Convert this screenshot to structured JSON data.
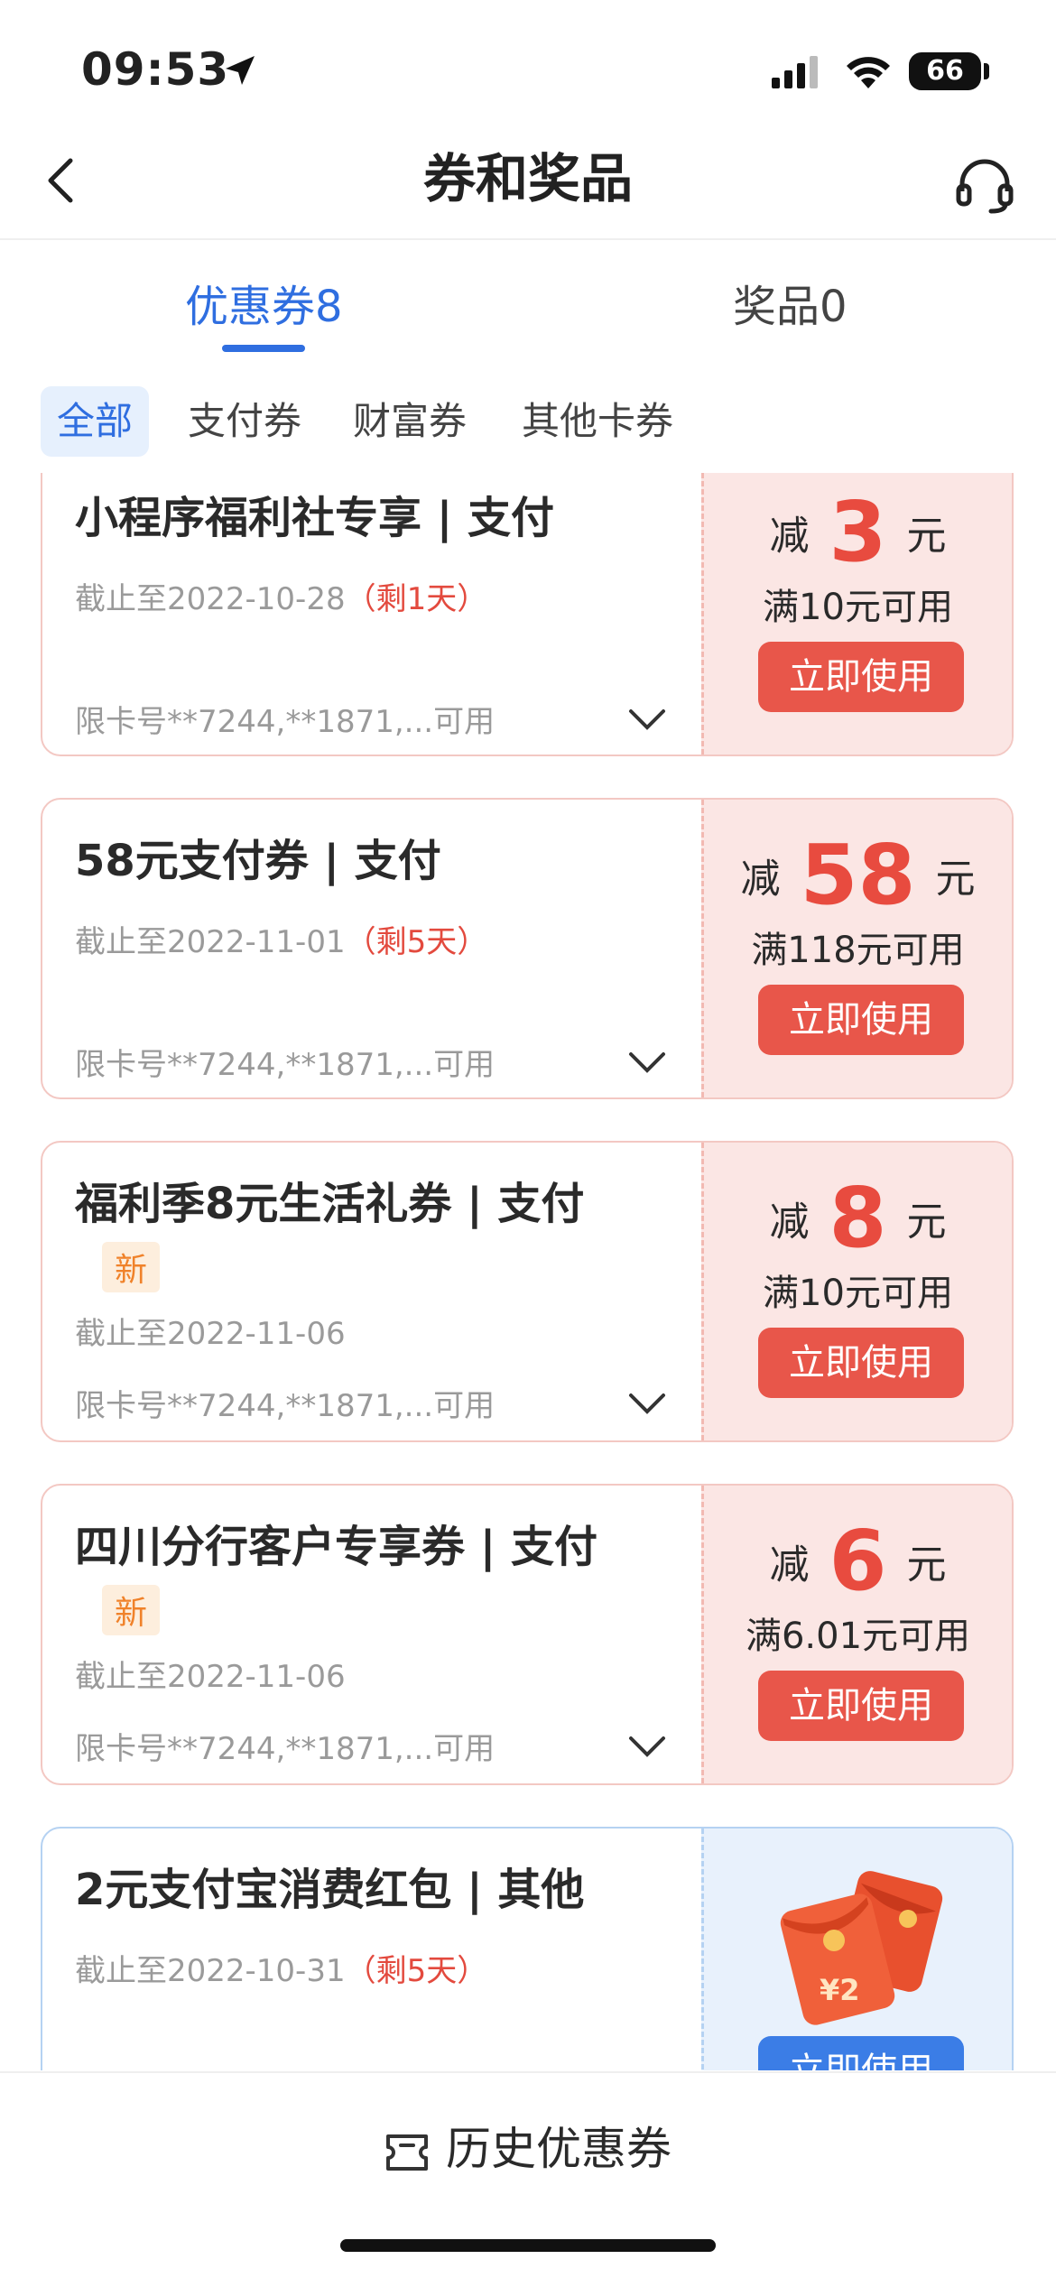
{
  "status_bar": {
    "time": "09:53",
    "battery": "66"
  },
  "nav": {
    "title": "券和奖品"
  },
  "tabs": [
    {
      "label": "优惠券8"
    },
    {
      "label": "奖品0"
    }
  ],
  "filters": [
    "全部",
    "支付券",
    "财富券",
    "其他卡券"
  ],
  "coupons": [
    {
      "title": "小程序福利社专享 | 支付",
      "is_new": false,
      "expiry": "截止至2022-10-28",
      "remaining": "（剩1天）",
      "card_limit": "限卡号**7244,**1871,...可用",
      "amount_prefix": "减",
      "amount": "3",
      "amount_unit": "元",
      "condition": "满10元可用",
      "button": "立即使用"
    },
    {
      "title": "58元支付券 | 支付",
      "is_new": false,
      "expiry": "截止至2022-11-01",
      "remaining": "（剩5天）",
      "card_limit": "限卡号**7244,**1871,...可用",
      "amount_prefix": "减",
      "amount": "58",
      "amount_unit": "元",
      "condition": "满118元可用",
      "button": "立即使用"
    },
    {
      "title": "福利季8元生活礼券 | 支付",
      "is_new": true,
      "new_label": "新",
      "expiry": "截止至2022-11-06",
      "remaining": "",
      "card_limit": "限卡号**7244,**1871,...可用",
      "amount_prefix": "减",
      "amount": "8",
      "amount_unit": "元",
      "condition": "满10元可用",
      "button": "立即使用"
    },
    {
      "title": "四川分行客户专享券 | 支付",
      "is_new": true,
      "new_label": "新",
      "expiry": "截止至2022-11-06",
      "remaining": "",
      "card_limit": "限卡号**7244,**1871,...可用",
      "amount_prefix": "减",
      "amount": "6",
      "amount_unit": "元",
      "condition": "满6.01元可用",
      "button": "立即使用"
    },
    {
      "title": "2元支付宝消费红包 | 其他",
      "is_new": false,
      "expiry": "截止至2022-10-31",
      "remaining": "（剩5天）",
      "redpacket_label": "¥2",
      "button": "立即使用"
    }
  ],
  "bottom": {
    "history_label": "历史优惠券"
  },
  "colors": {
    "accent_blue": "#2f6ee0",
    "accent_red": "#e84b3f",
    "button_red": "#e8564a",
    "new_orange": "#f0822a"
  }
}
